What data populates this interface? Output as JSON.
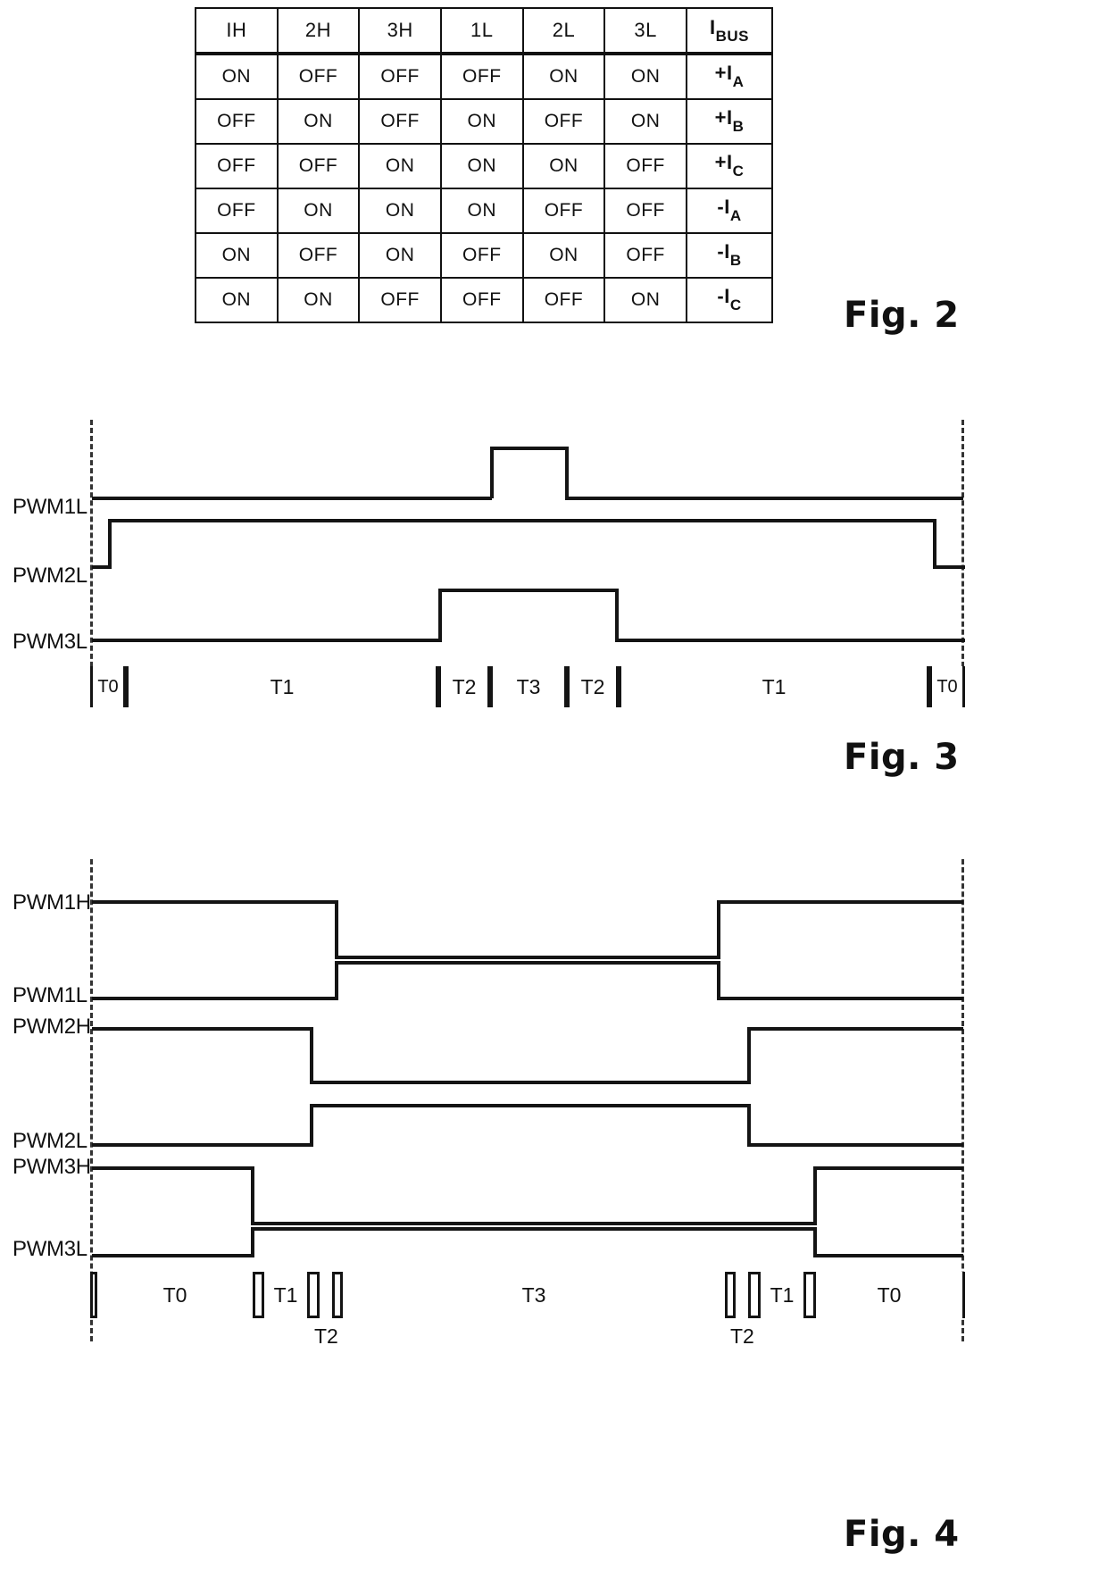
{
  "figures": {
    "fig2": {
      "caption": "Fig. 2",
      "table": {
        "headers": [
          "IH",
          "2H",
          "3H",
          "1L",
          "2L",
          "3L"
        ],
        "ibus_header": {
          "symbol": "I",
          "subscript": "BUS"
        },
        "rows": [
          {
            "states": [
              "ON",
              "OFF",
              "OFF",
              "OFF",
              "ON",
              "ON"
            ],
            "ibus": {
              "sign": "+I",
              "subscript": "A"
            }
          },
          {
            "states": [
              "OFF",
              "ON",
              "OFF",
              "ON",
              "OFF",
              "ON"
            ],
            "ibus": {
              "sign": "+I",
              "subscript": "B"
            }
          },
          {
            "states": [
              "OFF",
              "OFF",
              "ON",
              "ON",
              "ON",
              "OFF"
            ],
            "ibus": {
              "sign": "+I",
              "subscript": "C"
            }
          },
          {
            "states": [
              "OFF",
              "ON",
              "ON",
              "ON",
              "OFF",
              "OFF"
            ],
            "ibus": {
              "sign": "-I",
              "subscript": "A"
            }
          },
          {
            "states": [
              "ON",
              "OFF",
              "ON",
              "OFF",
              "ON",
              "OFF"
            ],
            "ibus": {
              "sign": "-I",
              "subscript": "B"
            }
          },
          {
            "states": [
              "ON",
              "ON",
              "OFF",
              "OFF",
              "OFF",
              "ON"
            ],
            "ibus": {
              "sign": "-I",
              "subscript": "C"
            }
          }
        ]
      }
    },
    "fig3": {
      "caption": "Fig. 3",
      "signals": [
        "PWM1L",
        "PWM2L",
        "PWM3L"
      ],
      "time_segments": [
        "T0",
        "T1",
        "T2",
        "T3",
        "T2",
        "T1",
        "T0"
      ]
    },
    "fig4": {
      "caption": "Fig. 4",
      "signals": [
        "PWM1H",
        "PWM1L",
        "PWM2H",
        "PWM2L",
        "PWM3H",
        "PWM3L"
      ],
      "time_segments": [
        "T0",
        "T1",
        "T2",
        "T3",
        "T2",
        "T1",
        "T0"
      ],
      "callout_labels": [
        "T2",
        "T2"
      ]
    }
  }
}
